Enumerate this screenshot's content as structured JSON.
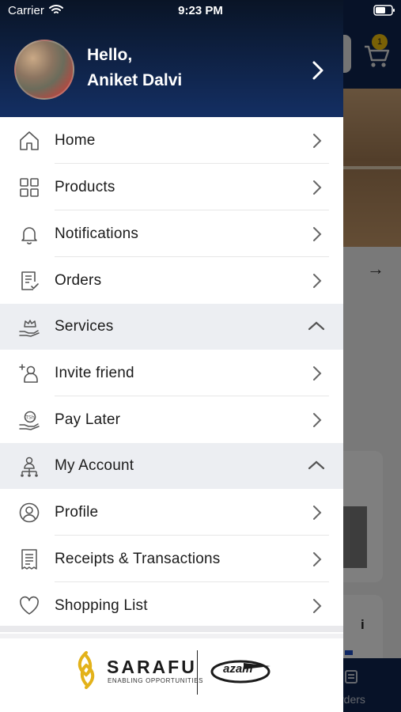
{
  "status_bar": {
    "carrier": "Carrier",
    "time": "9:23 PM"
  },
  "profile": {
    "greeting": "Hello,",
    "name": "Aniket Dalvi"
  },
  "menu": [
    {
      "label": "Home",
      "icon": "home-icon",
      "type": "link"
    },
    {
      "label": "Products",
      "icon": "grid-icon",
      "type": "link"
    },
    {
      "label": "Notifications",
      "icon": "bell-icon",
      "type": "link"
    },
    {
      "label": "Orders",
      "icon": "orders-icon",
      "type": "link"
    },
    {
      "label": "Services",
      "icon": "crown-hand-icon",
      "type": "section-expanded"
    },
    {
      "label": "Invite friend",
      "icon": "invite-friend-icon",
      "type": "link"
    },
    {
      "label": "Pay Later",
      "icon": "pay-later-icon",
      "type": "link"
    },
    {
      "label": "My Account",
      "icon": "account-tree-icon",
      "type": "section-expanded"
    },
    {
      "label": "Profile",
      "icon": "profile-icon",
      "type": "link"
    },
    {
      "label": "Receipts & Transactions",
      "icon": "receipt-icon",
      "type": "link"
    },
    {
      "label": "Shopping List",
      "icon": "heart-icon",
      "type": "link"
    }
  ],
  "footer": {
    "sarafu_name": "SARAFU",
    "sarafu_tagline": "ENABLING OPPORTUNITIES",
    "partner_name": "azam"
  },
  "background": {
    "cart_badge": "1",
    "tab_label": "rders"
  },
  "colors": {
    "header": "#0f2550",
    "section_bg": "#eceef2",
    "accent": "#f4c20d"
  }
}
